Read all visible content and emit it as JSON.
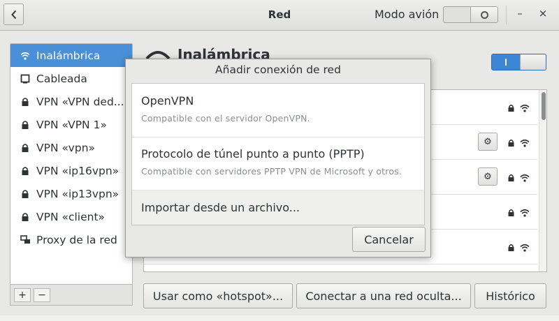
{
  "window": {
    "title": "Red",
    "airplane_mode_label": "Modo avión",
    "airplane_mode_on": false,
    "minimize_glyph": "–",
    "close_glyph": "×"
  },
  "sidebar": {
    "items": [
      {
        "label": "Inalámbrica",
        "icon": "wifi-icon",
        "selected": true
      },
      {
        "label": "Cableada",
        "icon": "ethernet-icon",
        "selected": false
      },
      {
        "label": "VPN «VPN ded...",
        "icon": "vpn-lock-icon",
        "selected": false
      },
      {
        "label": "VPN «VPN 1»",
        "icon": "vpn-lock-icon",
        "selected": false
      },
      {
        "label": "VPN «vpn»",
        "icon": "vpn-lock-icon",
        "selected": false
      },
      {
        "label": "VPN «ip16vpn»",
        "icon": "vpn-lock-icon",
        "selected": false
      },
      {
        "label": "VPN «ip13vpn»",
        "icon": "vpn-lock-icon",
        "selected": false
      },
      {
        "label": "VPN «client»",
        "icon": "vpn-lock-icon",
        "selected": false
      },
      {
        "label": "Proxy de la red",
        "icon": "proxy-icon",
        "selected": false
      }
    ],
    "add_glyph": "+",
    "remove_glyph": "−"
  },
  "main": {
    "title": "Inalámbrica",
    "wifi_enabled": true,
    "networks": [
      {
        "has_settings": false,
        "secured": true
      },
      {
        "has_settings": true,
        "secured": true
      },
      {
        "has_settings": true,
        "secured": true
      },
      {
        "has_settings": false,
        "secured": true
      },
      {
        "has_settings": false,
        "secured": true
      }
    ],
    "buttons": {
      "hotspot": "Usar como «hotspot»...",
      "hidden": "Conectar a una red oculta...",
      "history": "Histórico"
    }
  },
  "dialog": {
    "title": "Añadir conexión de red",
    "options": [
      {
        "title": "OpenVPN",
        "subtitle": "Compatible con el servidor OpenVPN."
      },
      {
        "title": "Protocolo de túnel punto a punto (PPTP)",
        "subtitle": "Compatible con servidores PPTP VPN de Microsoft y otros."
      }
    ],
    "import_label": "Importar desde un archivo...",
    "cancel_label": "Cancelar"
  },
  "colors": {
    "selection": "#4a90d9",
    "switch_on": "#3d86d6"
  }
}
